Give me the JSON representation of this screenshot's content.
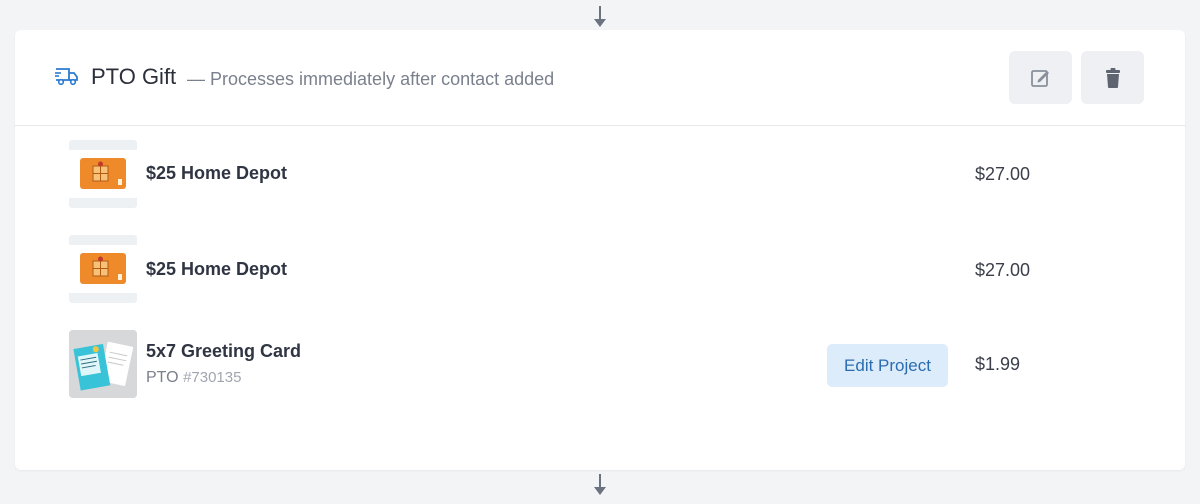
{
  "step": {
    "title": "PTO Gift",
    "subtitle": "— Processes immediately after contact added",
    "icon": "truck-icon",
    "actions": {
      "edit_icon": "edit-icon",
      "delete_icon": "trash-icon"
    }
  },
  "items": [
    {
      "name": "$25 Home Depot",
      "price": "$27.00",
      "thumbnail": "gift-card"
    },
    {
      "name": "$25 Home Depot",
      "price": "$27.00",
      "thumbnail": "gift-card"
    },
    {
      "name": "5x7 Greeting Card",
      "sub_label": "PTO",
      "sub_number": "#730135",
      "price": "$1.99",
      "edit_label": "Edit Project",
      "thumbnail": "greeting-card"
    }
  ],
  "colors": {
    "accent": "#2b6cb0",
    "accent_bg": "#dcecfb",
    "giftcard_orange": "#ef8a2a"
  }
}
